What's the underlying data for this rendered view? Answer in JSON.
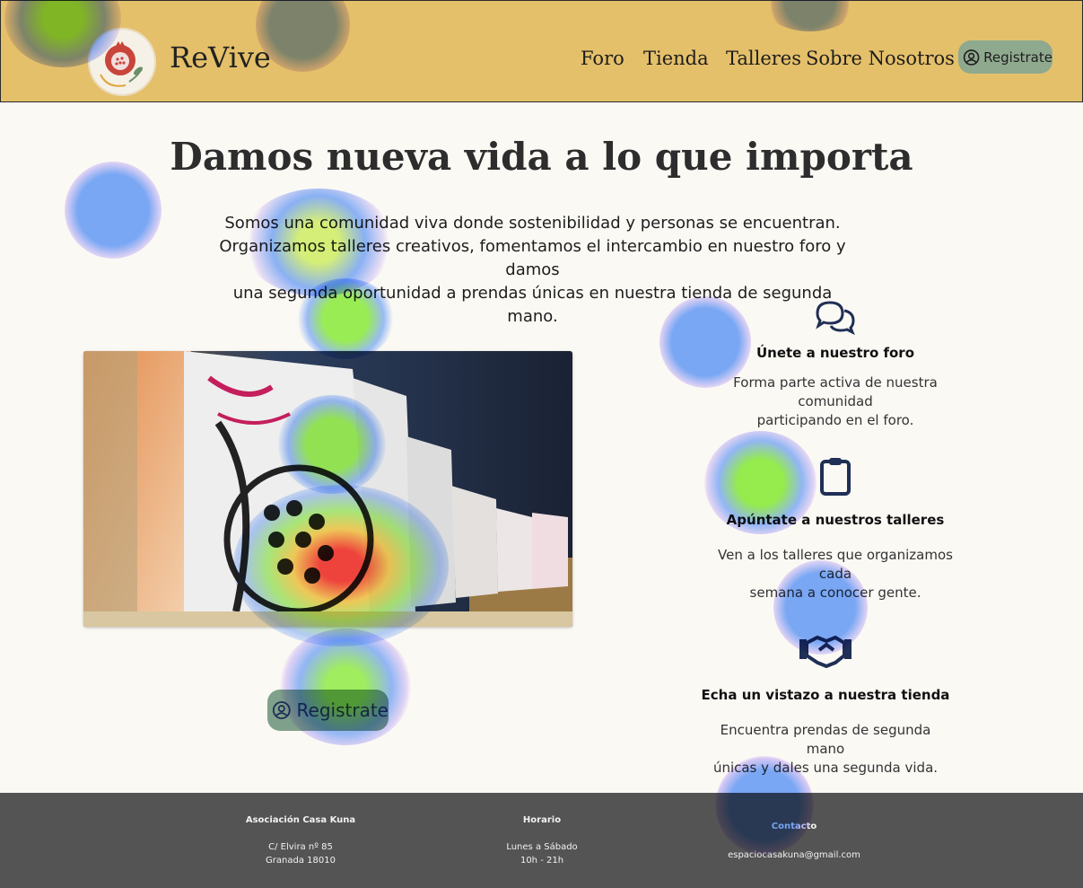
{
  "header": {
    "brand": "ReVive",
    "nav": [
      "Foro",
      "Tienda",
      "Talleres",
      "Sobre Nosotros"
    ],
    "register_label": "Registrate"
  },
  "hero": {
    "title": "Damos nueva vida a lo que importa",
    "intro_lines": [
      "Somos una comunidad viva donde sostenibilidad y personas se encuentran.",
      "Organizamos talleres creativos, fomentamos el intercambio en nuestro foro y damos",
      "una segunda oportunidad a prendas únicas en nuestra tienda de segunda mano."
    ],
    "register_label": "Registrate"
  },
  "features": [
    {
      "icon": "chat-bubbles-icon",
      "title": "Únete a nuestro foro",
      "desc_lines": [
        "Forma parte activa de nuestra comunidad",
        "participando en el foro."
      ]
    },
    {
      "icon": "clipboard-icon",
      "title": "Apúntate a nuestros talleres",
      "desc_lines": [
        "Ven a los talleres que organizamos cada",
        "semana a conocer gente."
      ]
    },
    {
      "icon": "handshake-icon",
      "title": "Echa un vistazo a nuestra tienda",
      "desc_lines": [
        "Encuentra prendas de segunda mano",
        "únicas y dales una segunda vida."
      ]
    }
  ],
  "footer": {
    "assoc_title": "Asociación Casa Kuna",
    "assoc_lines": [
      "C/ Elvira nº 85",
      "Granada 18010"
    ],
    "horario_title": "Horario",
    "horario_lines": [
      "Lunes a Sábado",
      "10h - 21h"
    ],
    "contacto_title": "Contacto",
    "contacto_email": "espaciocasakuna@gmail.com"
  },
  "colors": {
    "header_bg": "#e5c06a",
    "button_bg": "#8fa98f",
    "footer_bg": "#545454",
    "page_bg": "#fbf9f4",
    "icon_navy": "#1f2f55"
  }
}
